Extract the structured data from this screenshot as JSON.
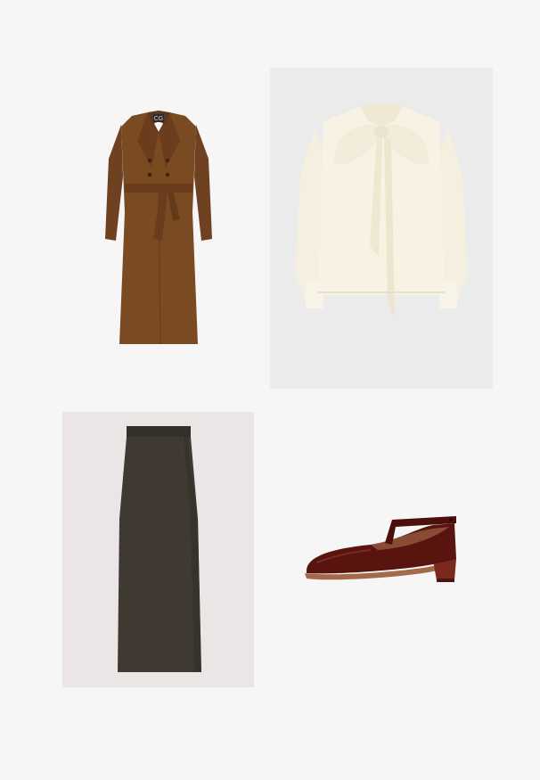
{
  "board": {
    "background": "#f6f6f6"
  },
  "items": [
    {
      "name": "coat",
      "description_color": "#7a4a22",
      "logo_text": "CG"
    },
    {
      "name": "blouse",
      "description_color": "#f5f0e1",
      "tile_color": "#ebebeb"
    },
    {
      "name": "skirt",
      "description_color": "#3b3630",
      "tile_color": "#ebe6e5"
    },
    {
      "name": "shoe",
      "description_color": "#5a1410"
    }
  ]
}
